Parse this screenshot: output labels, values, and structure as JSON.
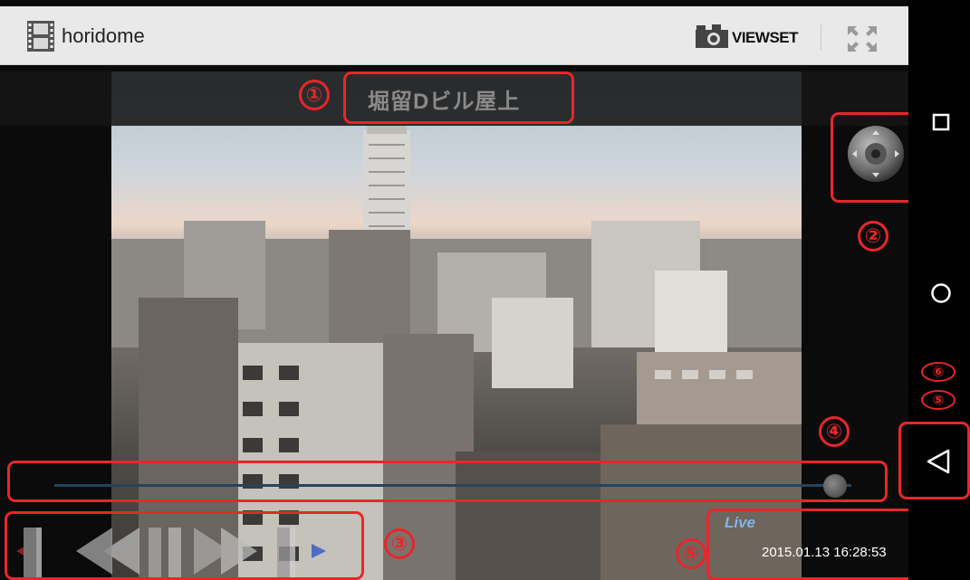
{
  "actionbar": {
    "app_title": "horidome",
    "viewset_label": "VIEWSET"
  },
  "camera": {
    "title": "堀留Dビル屋上"
  },
  "status": {
    "live_label": "Live",
    "timestamp": "2015.01.13 16:28:53"
  },
  "playback": {
    "position_fraction": 0.98
  },
  "annotations": [
    "①",
    "②",
    "③",
    "④",
    "⑤",
    "⑥",
    "⑤"
  ],
  "icons": {
    "app": "film-strip-icon",
    "viewset": "camera-icon",
    "fullscreen": "fullscreen-icon",
    "ptz": "ptz-joystick-icon",
    "nav_recent": "square-icon",
    "nav_home": "circle-icon",
    "nav_back": "back-triangle-icon"
  },
  "colors": {
    "annotation": "#e8262b",
    "live": "#7fb6e6",
    "actionbar": "#e9e9e9"
  }
}
